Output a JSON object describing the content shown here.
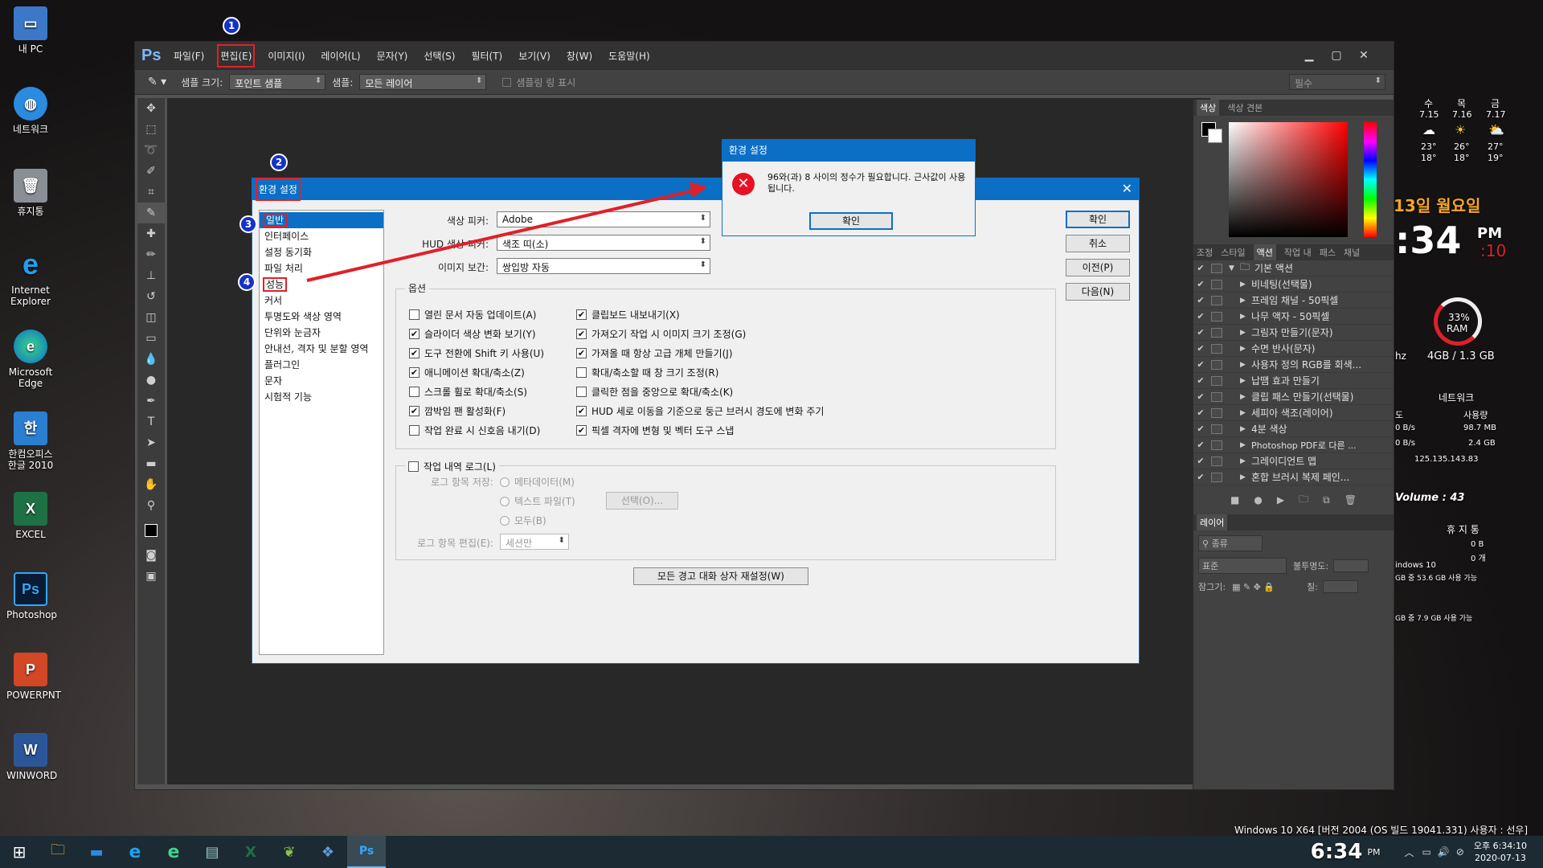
{
  "desktop": {
    "icons": [
      {
        "label": "내 PC"
      },
      {
        "label": "네트워크"
      },
      {
        "label": "휴지통"
      },
      {
        "label": "Internet Explorer"
      },
      {
        "label": "Microsoft Edge"
      },
      {
        "label": "한컴오피스 한글 2010"
      },
      {
        "label": "EXCEL"
      },
      {
        "label": "Photoshop"
      },
      {
        "label": "POWERPNT"
      },
      {
        "label": "WINWORD"
      }
    ]
  },
  "photoshop": {
    "logo": "Ps",
    "menu": [
      "파일(F)",
      "편집(E)",
      "이미지(I)",
      "레이어(L)",
      "문자(Y)",
      "선택(S)",
      "필터(T)",
      "보기(V)",
      "창(W)",
      "도움말(H)"
    ],
    "options": {
      "sample_size_label": "샘플 크기:",
      "sample_size_value": "포인트 샘플",
      "sample_label": "샘플:",
      "sample_value": "모든 레이어",
      "show_ring": "샘플링 링 표시",
      "workspace": "필수"
    },
    "color_panel_tabs": [
      "색상",
      "색상 견본"
    ],
    "actions_tabs": [
      "조정",
      "스타일",
      "액션",
      "작업 내",
      "패스",
      "채널"
    ],
    "actions": [
      {
        "label": "기본 액션",
        "folder": true
      },
      {
        "label": "비네팅(선택물)"
      },
      {
        "label": "프레임 채널 - 50픽셀"
      },
      {
        "label": "나무 액자 - 50픽셀"
      },
      {
        "label": "그림자 만들기(문자)"
      },
      {
        "label": "수면 반사(문자)"
      },
      {
        "label": "사용자 정의 RGB를 회색..."
      },
      {
        "label": "납땜 효과 만들기"
      },
      {
        "label": "클립 패스 만들기(선택물)"
      },
      {
        "label": "세피아 색조(레이어)"
      },
      {
        "label": "4분 색상"
      },
      {
        "label": "Photoshop PDF로 다른 ..."
      },
      {
        "label": "그레이디언트 맵"
      },
      {
        "label": "혼합 브러시 복제 페인..."
      }
    ],
    "layers": {
      "tab": "레이어",
      "filter": "종류",
      "blend": "표준",
      "opacity_label": "불투명도:",
      "lock_label": "잠그기:",
      "fill_label": "칠:"
    }
  },
  "prefs": {
    "title": "환경 설정",
    "nav": [
      "일반",
      "인터페이스",
      "설정 동기화",
      "파일 처리",
      "성능",
      "커서",
      "투명도와 색상 영역",
      "단위와 눈금자",
      "안내선, 격자 및 분할 영역",
      "플러그인",
      "문자",
      "시험적 기능"
    ],
    "color_picker_label": "색상 피커:",
    "color_picker_value": "Adobe",
    "hud_label": "HUD 색상 피커:",
    "hud_value": "색조 띠(소)",
    "interp_label": "이미지 보간:",
    "interp_value": "쌍입방 자동",
    "options_title": "옵션",
    "options_left": [
      {
        "label": "열린 문서 자동 업데이트(A)",
        "checked": false
      },
      {
        "label": "슬라이더 색상 변화 보기(Y)",
        "checked": true
      },
      {
        "label": "도구 전환에 Shift 키 사용(U)",
        "checked": true
      },
      {
        "label": "애니메이션 확대/축소(Z)",
        "checked": true
      },
      {
        "label": "스크롤 휠로 확대/축소(S)",
        "checked": false
      },
      {
        "label": "깜박임 팬 활성화(F)",
        "checked": true
      },
      {
        "label": "작업 완료 시 신호음 내기(D)",
        "checked": false
      }
    ],
    "options_right": [
      {
        "label": "클립보드 내보내기(X)",
        "checked": true
      },
      {
        "label": "가져오기 작업 시 이미지 크기 조정(G)",
        "checked": true
      },
      {
        "label": "가져올 때 항상 고급 개체 만들기(J)",
        "checked": true
      },
      {
        "label": "확대/축소할 때 창 크기 조정(R)",
        "checked": false
      },
      {
        "label": "클릭한 점을 중앙으로 확대/축소(K)",
        "checked": false
      },
      {
        "label": "HUD 세로 이동을 기준으로 둥근 브러시 경도에 변화 주기",
        "checked": true
      },
      {
        "label": "픽셀 격자에 변형 및 벡터 도구 스냅",
        "checked": true
      }
    ],
    "history_title": "작업 내역 로그(L)",
    "save_log_label": "로그 항목 저장:",
    "radio_meta": "메타데이터(M)",
    "radio_text": "텍스트 파일(T)",
    "radio_both": "모두(B)",
    "choose_btn": "선택(O)...",
    "edit_log_label": "로그 항목 편집(E):",
    "edit_log_value": "세션만",
    "reset_warnings": "모든 경고 대화 상자 재설정(W)",
    "btn_ok": "확인",
    "btn_cancel": "취소",
    "btn_prev": "이전(P)",
    "btn_next": "다음(N)"
  },
  "alert": {
    "title": "환경 설정",
    "message": "96와(과) 8 사이의 정수가 필요합니다. 근사값이 사용됩니다.",
    "ok": "확인"
  },
  "badges": [
    "1",
    "2",
    "3",
    "4"
  ],
  "widgets": {
    "days": [
      {
        "day": "수",
        "date": "7.15",
        "hi": "23°",
        "lo": "18°"
      },
      {
        "day": "목",
        "date": "7.16",
        "hi": "26°",
        "lo": "18°"
      },
      {
        "day": "금",
        "date": "7.17",
        "hi": "27°",
        "lo": "19°"
      }
    ],
    "date_text": "13일 월요일",
    "time": ":34",
    "ampm": "PM",
    "seconds": ":10",
    "ram_percent": "33%",
    "ram_label": "RAM",
    "ram_usage": "4GB / 1.3 GB",
    "hz": "hz",
    "network_title": "네트워크",
    "net_speed_label": "도",
    "net_usage_label": "사용량",
    "net_rows": [
      {
        "a": "0 B/s",
        "b": "98.7 MB"
      },
      {
        "a": "0 B/s",
        "b": "2.4 GB"
      }
    ],
    "ip": "125.135.143.83",
    "volume": "Volume : 43",
    "recycle": "휴 지 통",
    "recycle_size": "0 B",
    "recycle_count": "0 개",
    "disk1": "indows 10",
    "disk1_info": "GB 중  53.6 GB 사용 가능",
    "disk2_info": "GB 중  7.9 GB 사용 가능",
    "os_info": "Windows 10 X64 [버전 2004 (OS 빌드 19041.331) 사용자 : 선우]"
  },
  "taskbar": {
    "time_big": "6:34",
    "time_ampm": "PM",
    "tray_time": "오후 6:34:10",
    "tray_date": "2020-07-13"
  }
}
